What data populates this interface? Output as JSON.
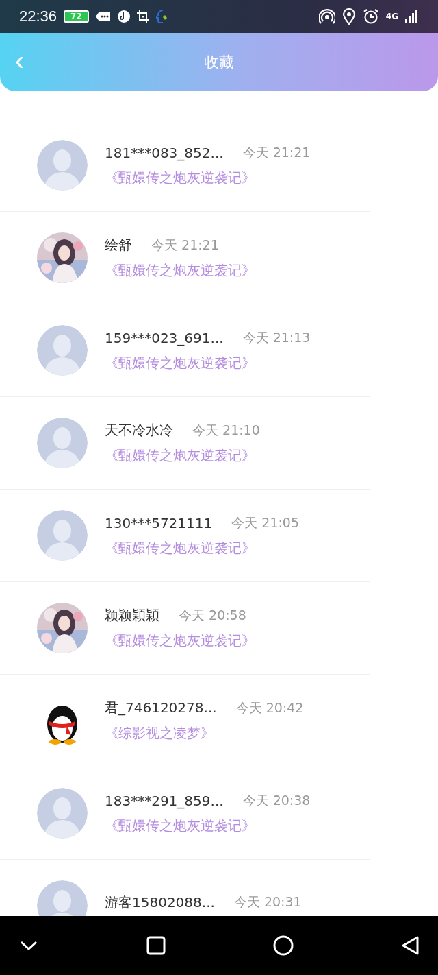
{
  "status_bar": {
    "time": "22:36",
    "battery": "72",
    "network": "4G"
  },
  "header": {
    "back": "‹",
    "title": "收藏"
  },
  "favorites": [
    {
      "name": "181***083_852...",
      "time": "今天 21:21",
      "book": "《甄嬛传之炮灰逆袭记》",
      "kind": "default"
    },
    {
      "name": "绘舒",
      "time": "今天 21:21",
      "book": "《甄嬛传之炮灰逆袭记》",
      "kind": "picture"
    },
    {
      "name": "159***023_691...",
      "time": "今天 21:13",
      "book": "《甄嬛传之炮灰逆袭记》",
      "kind": "default"
    },
    {
      "name": "天不冷水冷",
      "time": "今天 21:10",
      "book": "《甄嬛传之炮灰逆袭记》",
      "kind": "default"
    },
    {
      "name": "130***5721111",
      "time": "今天 21:05",
      "book": "《甄嬛传之炮灰逆袭记》",
      "kind": "default"
    },
    {
      "name": "颖颖穎穎",
      "time": "今天 20:58",
      "book": "《甄嬛传之炮灰逆袭记》",
      "kind": "picture"
    },
    {
      "name": "君_746120278...",
      "time": "今天 20:42",
      "book": "《综影视之凌梦》",
      "kind": "penguin"
    },
    {
      "name": "183***291_859...",
      "time": "今天 20:38",
      "book": "《甄嬛传之炮灰逆袭记》",
      "kind": "default"
    },
    {
      "name": "游客15802088...",
      "time": "今天 20:31",
      "kind": "default"
    }
  ]
}
